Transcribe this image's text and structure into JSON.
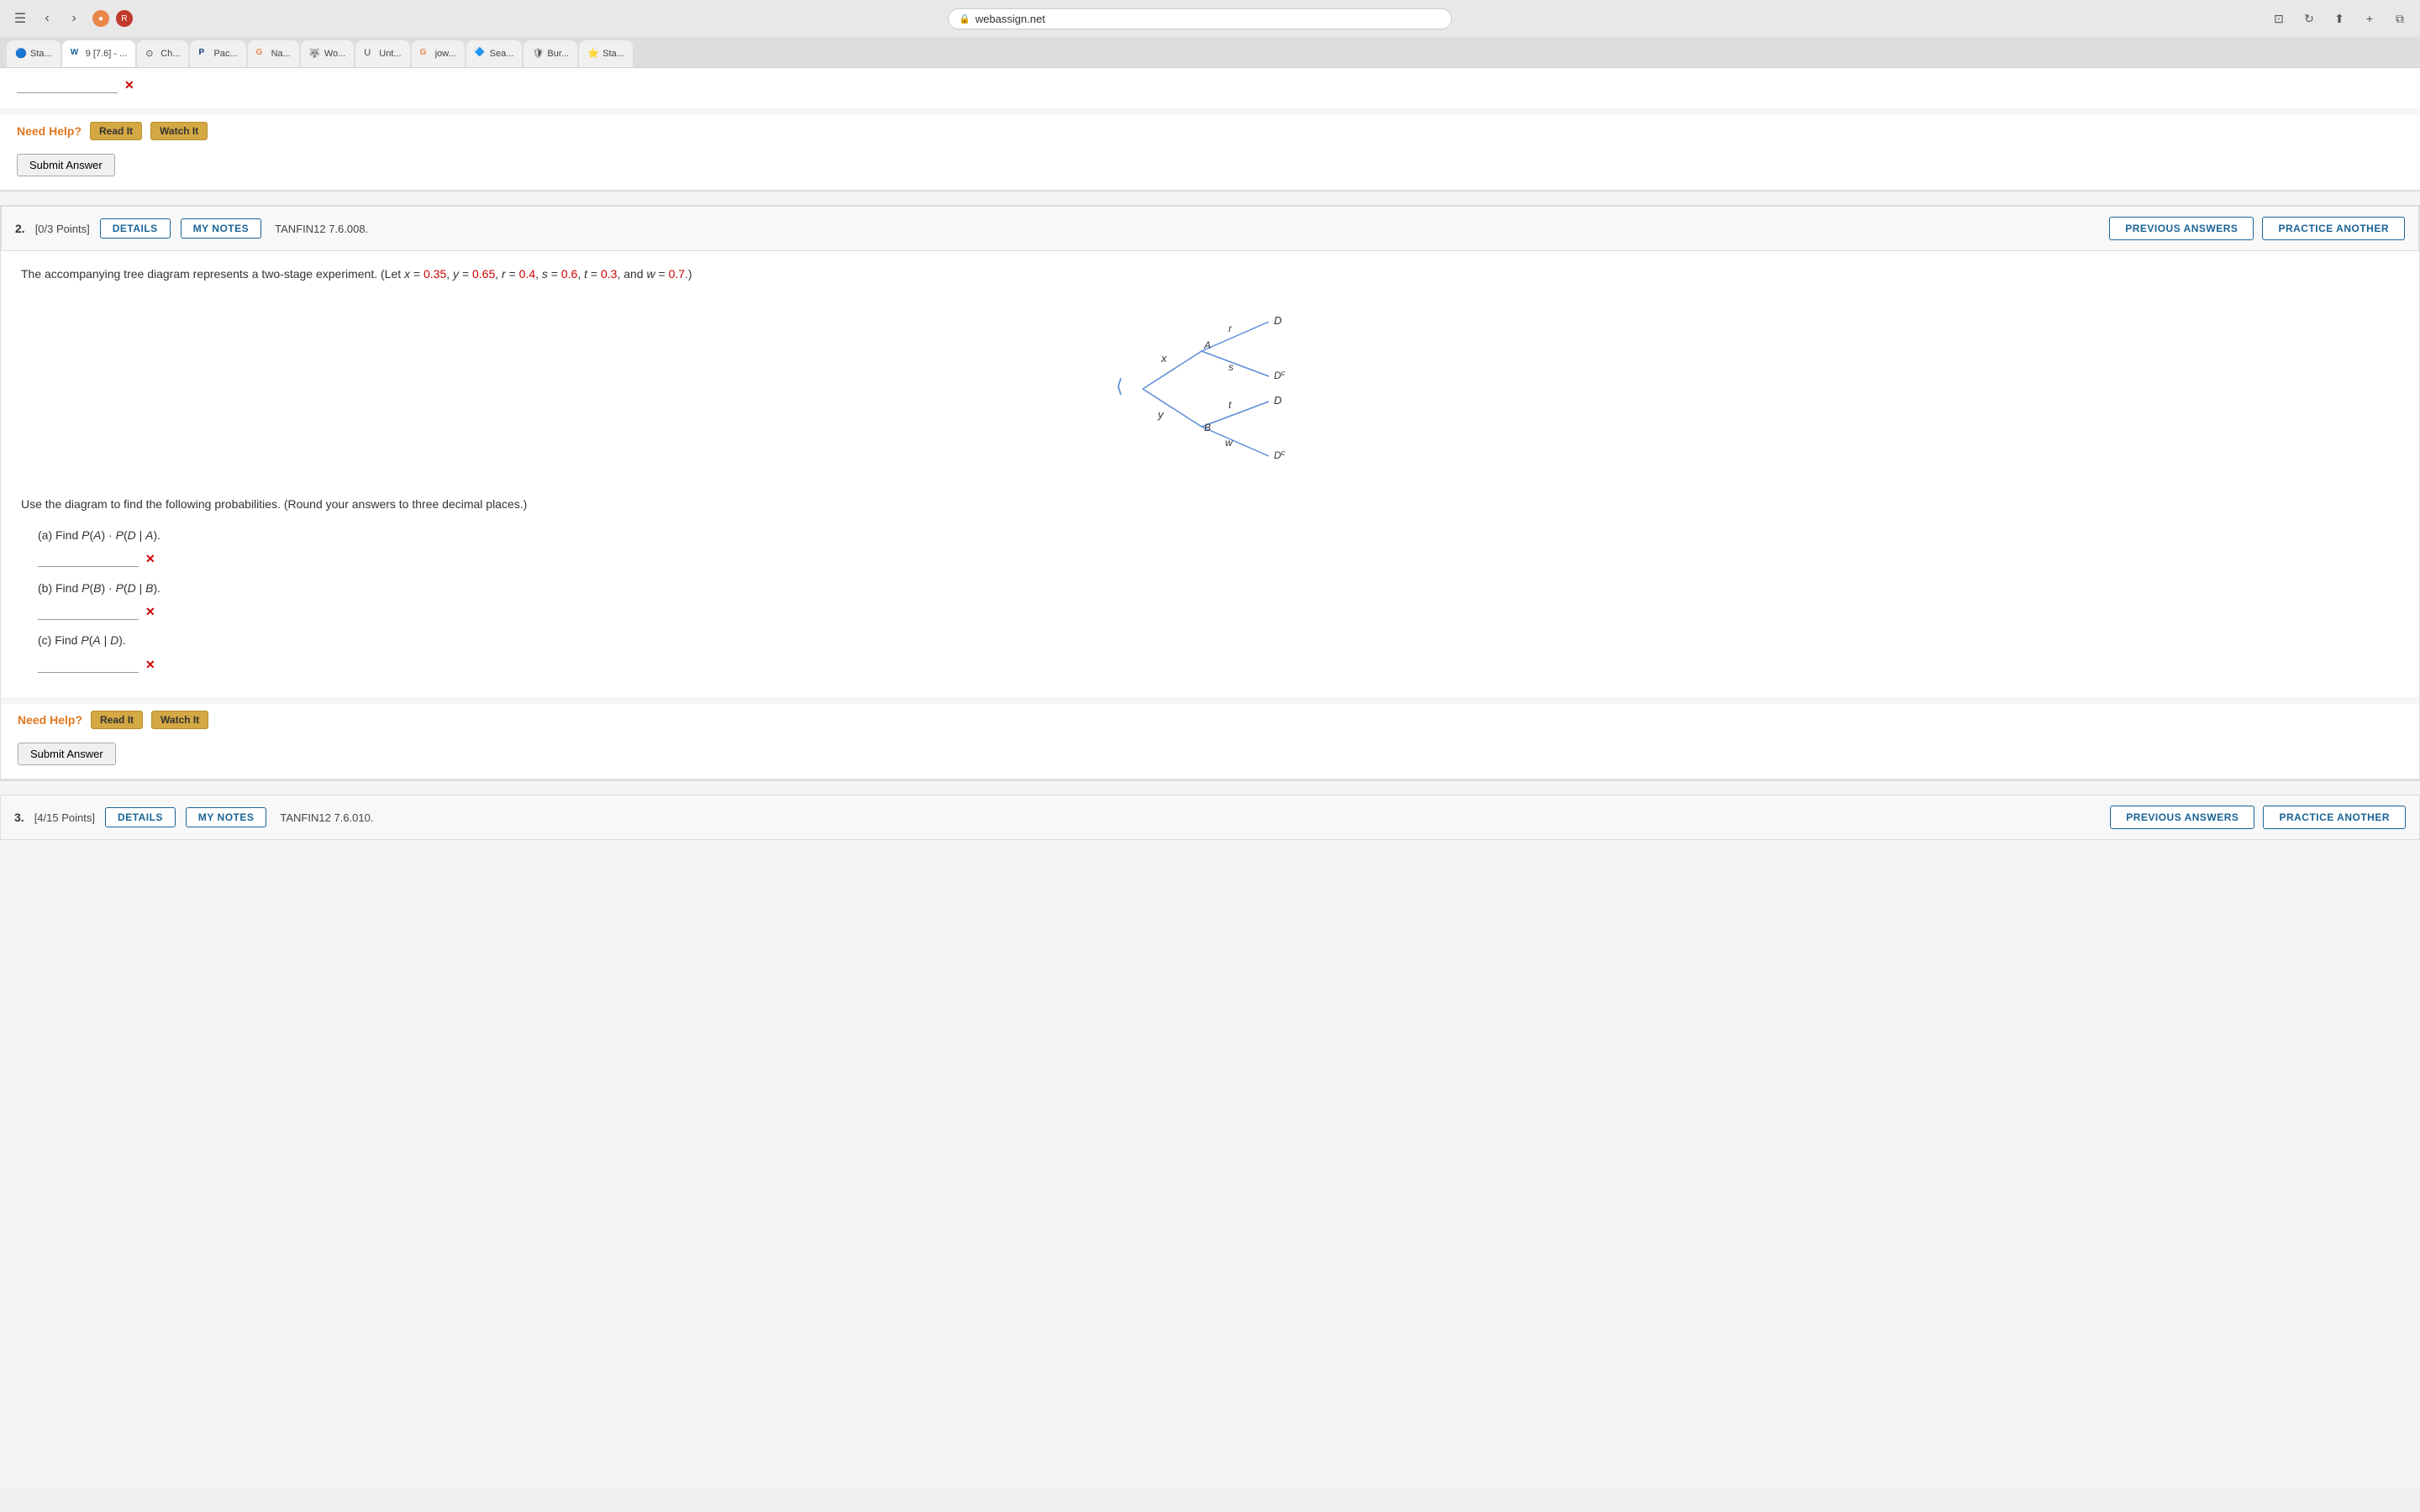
{
  "browser": {
    "url": "webassign.net",
    "tabs": [
      {
        "id": "t1",
        "favicon": "🔵",
        "title": "Sta...",
        "active": false
      },
      {
        "id": "t2",
        "favicon": "W",
        "title": "9 [7.6] - ...",
        "active": true
      },
      {
        "id": "t3",
        "favicon": "⊙",
        "title": "Ch...",
        "active": false
      },
      {
        "id": "t4",
        "favicon": "P",
        "title": "Pac...",
        "active": false
      },
      {
        "id": "t5",
        "favicon": "G",
        "title": "Na...",
        "active": false
      },
      {
        "id": "t6",
        "favicon": "🐺",
        "title": "Wo...",
        "active": false
      },
      {
        "id": "t7",
        "favicon": "U",
        "title": "Unt...",
        "active": false
      },
      {
        "id": "t8",
        "favicon": "G",
        "title": "jow...",
        "active": false
      },
      {
        "id": "t9",
        "favicon": "🔷",
        "title": "Sea...",
        "active": false
      },
      {
        "id": "t10",
        "favicon": "🛡",
        "title": "Bur...",
        "active": false
      },
      {
        "id": "t11",
        "favicon": "⭐",
        "title": "Sta...",
        "active": false
      }
    ],
    "bookmarks": [
      {
        "label": "Sta..."
      },
      {
        "label": "Ch..."
      },
      {
        "label": "Pac..."
      },
      {
        "label": "Na..."
      },
      {
        "label": "Wo..."
      },
      {
        "label": "Unt..."
      },
      {
        "label": "jow..."
      },
      {
        "label": "Sea..."
      },
      {
        "label": "Bur..."
      }
    ]
  },
  "page": {
    "top_section": {
      "answer_placeholder": "",
      "need_help_label": "Need Help?",
      "read_it_label": "Read It",
      "watch_it_label": "Watch It",
      "submit_label": "Submit Answer"
    },
    "question2": {
      "number": "2.",
      "points": "[0/3 Points]",
      "details_label": "DETAILS",
      "my_notes_label": "MY NOTES",
      "question_code": "TANFIN12 7.6.008.",
      "previous_answers_label": "PREVIOUS ANSWERS",
      "practice_another_label": "PRACTICE ANOTHER",
      "intro_text": "The accompanying tree diagram represents a two-stage experiment. (Let",
      "variables": {
        "x": "x = 0.35",
        "y": "y = 0.65",
        "r": "r = 0.4",
        "s": "s = 0.6",
        "t": "t = 0.3",
        "w": "w = 0.7"
      },
      "diagram_labels": {
        "x": "x",
        "y": "y",
        "A": "A",
        "B": "B",
        "r": "r",
        "s": "s",
        "t": "t",
        "w": "w",
        "D1": "D",
        "Dc1": "Dᶜ",
        "D2": "D",
        "Dc2": "Dᶜ"
      },
      "instruction": "Use the diagram to find the following probabilities. (Round your answers to three decimal places.)",
      "sub_questions": [
        {
          "label": "(a) Find",
          "expression": "P(A) · P(D | A).",
          "has_error": true
        },
        {
          "label": "(b) Find",
          "expression": "P(B) · P(D | B).",
          "has_error": true
        },
        {
          "label": "(c) Find",
          "expression": "P(A | D).",
          "has_error": true
        }
      ],
      "need_help_label": "Need Help?",
      "read_it_label": "Read It",
      "watch_it_label": "Watch It",
      "submit_label": "Submit Answer"
    },
    "question3": {
      "number": "3.",
      "points": "[4/15 Points]",
      "details_label": "DETAILS",
      "my_notes_label": "MY NOTES",
      "question_code": "TANFIN12 7.6.010.",
      "previous_answers_label": "PREVIOUS ANSWERS",
      "practice_another_label": "PRACTICE ANOTHER"
    }
  }
}
